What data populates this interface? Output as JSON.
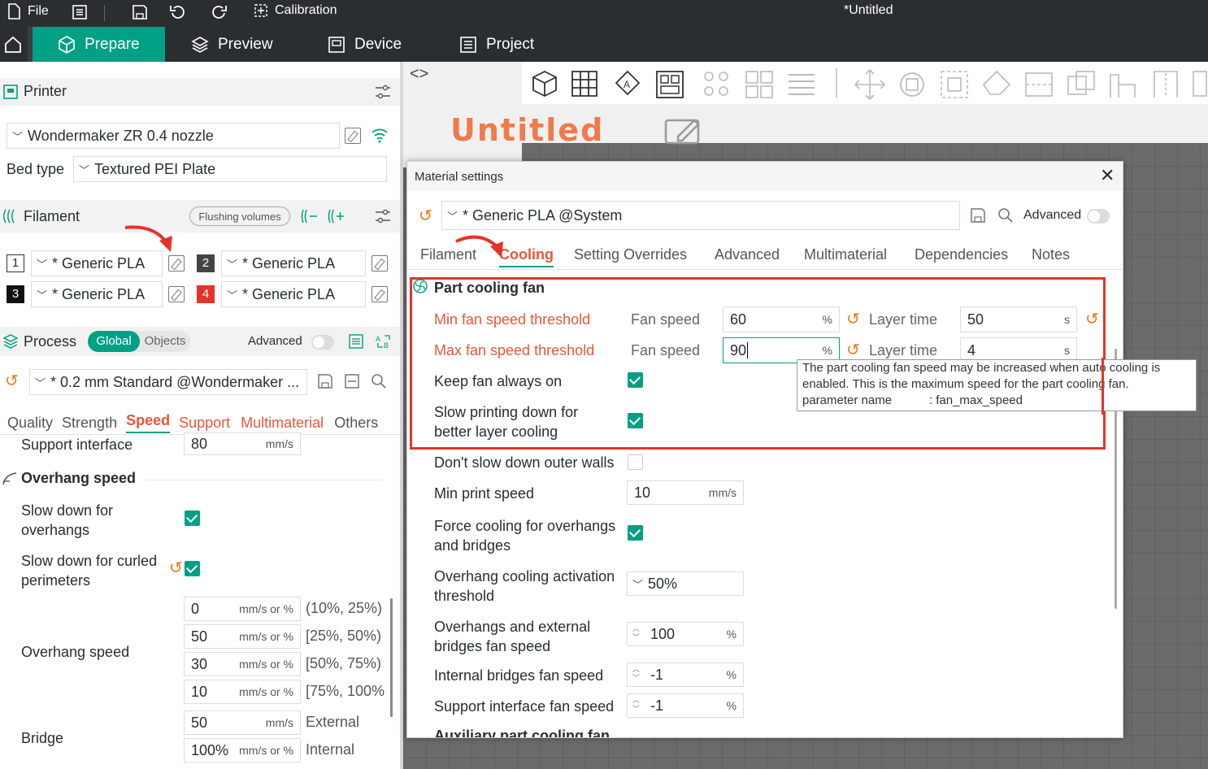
{
  "titlebar": {
    "file": "File",
    "calibration": "Calibration",
    "window_title": "*Untitled"
  },
  "tabs": {
    "prepare": "Prepare",
    "preview": "Preview",
    "device": "Device",
    "project": "Project"
  },
  "printer": {
    "section": "Printer",
    "name": "Wondermaker ZR 0.4 nozzle",
    "bed_label": "Bed type",
    "bed_value": "Textured PEI Plate"
  },
  "filament": {
    "section": "Filament",
    "flushing": "Flushing volumes",
    "slots": [
      {
        "num": "1",
        "name": "* Generic PLA"
      },
      {
        "num": "2",
        "name": "* Generic PLA"
      },
      {
        "num": "3",
        "name": "* Generic PLA"
      },
      {
        "num": "4",
        "name": "* Generic PLA"
      }
    ]
  },
  "process": {
    "section": "Process",
    "global": "Global",
    "objects": "Objects",
    "advanced": "Advanced",
    "preset": "* 0.2 mm  Standard @Wondermaker ...",
    "tabs": [
      "Quality",
      "Strength",
      "Speed",
      "Support",
      "Multimaterial",
      "Others"
    ]
  },
  "speed": {
    "support_interface_label": "Support interface",
    "support_interface_value": "80",
    "unit_mms": "mm/s",
    "unit_mms_or": "mm/s or %",
    "overhang_header": "Overhang speed",
    "slow_overhangs": "Slow down for overhangs",
    "slow_curled": "Slow down for curled perimeters",
    "overhang_label": "Overhang speed",
    "overhang_rows": [
      {
        "value": "0",
        "range": "(10%, 25%)"
      },
      {
        "value": "50",
        "range": "[25%, 50%)"
      },
      {
        "value": "30",
        "range": "[50%, 75%)"
      },
      {
        "value": "10",
        "range": "[75%, 100%"
      }
    ],
    "bridge_label": "Bridge",
    "bridge_external_value": "50",
    "bridge_external_label": "External",
    "bridge_internal_value": "100%",
    "bridge_internal_label": "Internal"
  },
  "viewport": {
    "plate_title": "Untitled"
  },
  "dialog": {
    "title": "Material settings",
    "preset": "* Generic PLA @System",
    "advanced": "Advanced",
    "tabs": [
      "Filament",
      "Cooling",
      "Setting Overrides",
      "Advanced",
      "Multimaterial",
      "Dependencies",
      "Notes"
    ],
    "part_cooling_header": "Part cooling fan",
    "min_fan_label": "Min fan speed threshold",
    "max_fan_label": "Max fan speed threshold",
    "fan_speed": "Fan speed",
    "layer_time": "Layer time",
    "pct": "%",
    "s": "s",
    "min_fan_value": "60",
    "min_layer_value": "50",
    "max_fan_value": "90",
    "max_layer_value": "4",
    "keep_fan": "Keep fan always on",
    "slow_printing": "Slow printing down for better layer cooling",
    "dont_slow": "Don't slow down outer walls",
    "min_print_speed": "Min print speed",
    "min_print_value": "10",
    "mms": "mm/s",
    "force_cooling": "Force cooling for overhangs and bridges",
    "overhang_threshold": "Overhang cooling activation threshold",
    "overhang_threshold_value": "50%",
    "overhang_fan": "Overhangs and external bridges fan speed",
    "overhang_fan_value": "100",
    "internal_bridges": "Internal bridges fan speed",
    "internal_bridges_value": "-1",
    "support_fan": "Support interface fan speed",
    "support_fan_value": "-1",
    "aux_header": "Auxiliary part cooling fan",
    "tooltip_line1": "The part cooling fan speed may be increased when auto cooling is",
    "tooltip_line2": "enabled. This is the maximum speed for the part cooling fan.",
    "tooltip_line3": "parameter name           : fan_max_speed"
  },
  "colors": {
    "accent": "#00a085",
    "highlight": "#e8573a",
    "annotation": "#e5332a",
    "topbar": "#2a2e30"
  }
}
